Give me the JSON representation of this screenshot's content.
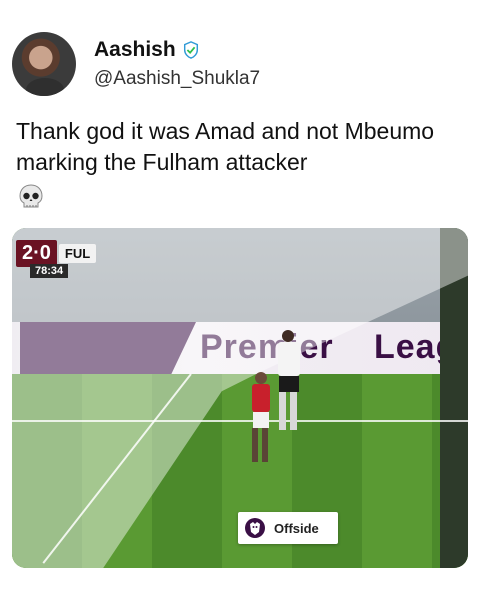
{
  "user": {
    "name": "Aashish",
    "handle": "@Aashish_Shukla7",
    "verified_icon": "green-shield-check-icon"
  },
  "tweet": {
    "text": "Thank god it was Amad and not Mbeumo marking the Fulham attacker",
    "emoji_icon": "skull-icon"
  },
  "media": {
    "scorebug": {
      "home_score": "2",
      "away_score": "0",
      "away_team": "FUL",
      "clock": "78:34"
    },
    "board_left": "Premier",
    "board_right": "Leagu",
    "badge": {
      "label": "Offside",
      "icon": "premier-league-lion-icon"
    },
    "colors": {
      "pitch": "#4c8a2b",
      "board_purple": "#3a0f45",
      "home_red": "#6a1223"
    }
  }
}
